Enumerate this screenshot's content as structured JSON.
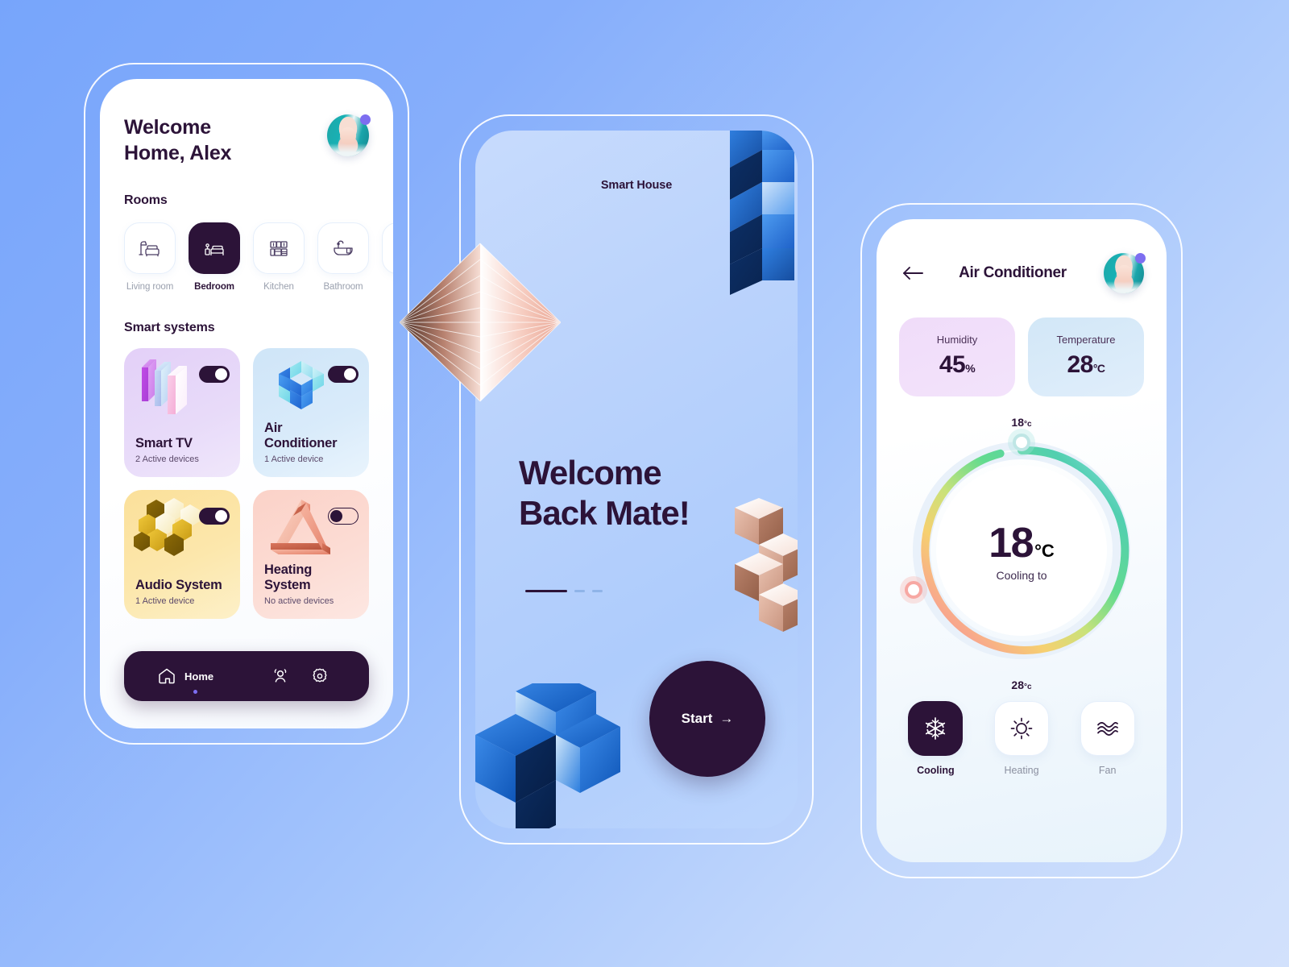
{
  "background": {
    "from": "#77a5fb",
    "to": "#d2e1fc"
  },
  "accent": {
    "dark": "#2c1338",
    "dot": "#7d6ef0"
  },
  "phone_home": {
    "welcome_line1": "Welcome",
    "welcome_line2": "Home, Alex",
    "rooms_title": "Rooms",
    "rooms": [
      {
        "label": "Living room",
        "icon": "living-room-icon",
        "active": false
      },
      {
        "label": "Bedroom",
        "icon": "bedroom-icon",
        "active": true
      },
      {
        "label": "Kitchen",
        "icon": "kitchen-icon",
        "active": false
      },
      {
        "label": "Bathroom",
        "icon": "bathroom-icon",
        "active": false
      }
    ],
    "smart_title": "Smart systems",
    "systems": [
      {
        "name": "Smart TV",
        "sub": "2 Active devices",
        "toggle": "on",
        "color": "#e3d0f8"
      },
      {
        "name": "Air Conditioner",
        "sub": "1 Active device",
        "toggle": "on",
        "color": "#cfe5f8"
      },
      {
        "name": "Audio System",
        "sub": "1 Active device",
        "toggle": "on",
        "color": "#fbe09a"
      },
      {
        "name": "Heating System",
        "sub": "No active devices",
        "toggle": "off",
        "color": "#fbd2c8"
      }
    ],
    "nav": {
      "home_label": "Home",
      "items": [
        "home-icon",
        "users-icon",
        "gear-icon"
      ]
    }
  },
  "phone_welcome": {
    "brand": "Smart House",
    "headline_line1": "Welcome",
    "headline_line2": "Back Mate!",
    "pager": {
      "total": 3,
      "current": 1
    },
    "start_label": "Start",
    "start_arrow": "→"
  },
  "phone_ac": {
    "title": "Air Conditioner",
    "back_icon": "arrow-left-icon",
    "stats": [
      {
        "label": "Humidity",
        "value": "45",
        "unit": "%"
      },
      {
        "label": "Temperature",
        "value": "28",
        "unit": "°C"
      }
    ],
    "dial": {
      "min_label": "18",
      "min_unit": "°c",
      "max_label": "28",
      "max_unit": "°c",
      "current": "18",
      "current_unit": "°C",
      "status": "Cooling to"
    },
    "modes": [
      {
        "label": "Cooling",
        "icon": "snowflake-icon",
        "active": true
      },
      {
        "label": "Heating",
        "icon": "sun-icon",
        "active": false
      },
      {
        "label": "Fan",
        "icon": "waves-icon",
        "active": false
      }
    ]
  }
}
